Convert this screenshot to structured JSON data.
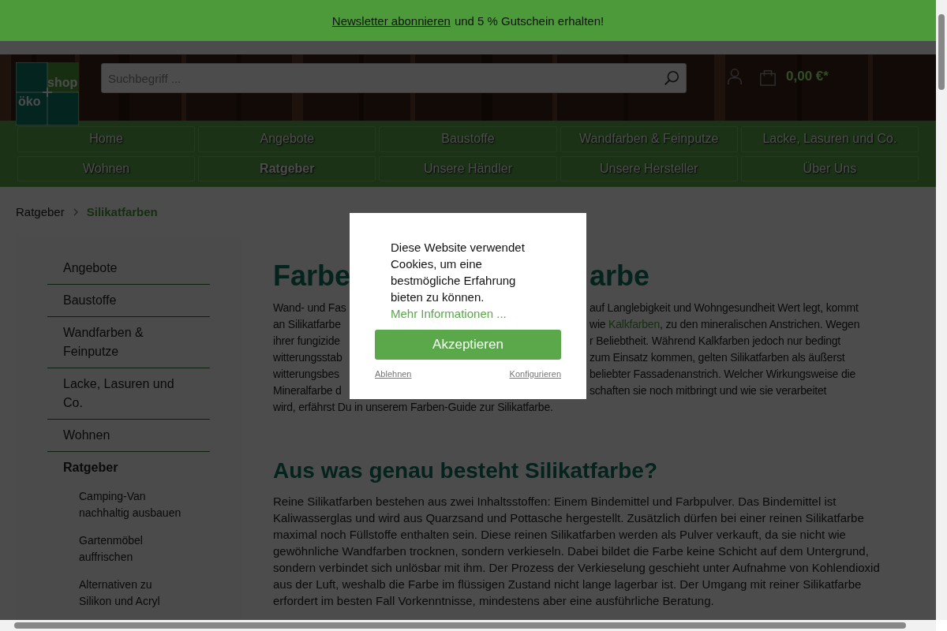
{
  "banner": {
    "link": "Newsletter abonnieren",
    "text": "und 5 % Gutschein erhalten!"
  },
  "logo": {
    "left": "öko",
    "right": "shop"
  },
  "search": {
    "placeholder": "Suchbegriff ..."
  },
  "cart": {
    "total": "0,00 €*"
  },
  "nav": [
    {
      "label": "Home",
      "selected": false
    },
    {
      "label": "Angebote",
      "selected": false
    },
    {
      "label": "Baustoffe",
      "selected": false
    },
    {
      "label": "Wandfarben & Feinputze",
      "selected": false
    },
    {
      "label": "Lacke, Lasuren und Co.",
      "selected": false
    },
    {
      "label": "Wohnen",
      "selected": false
    },
    {
      "label": "Ratgeber",
      "selected": true
    },
    {
      "label": "Unsere Händler",
      "selected": false
    },
    {
      "label": "Unsere Hersteller",
      "selected": false
    },
    {
      "label": "Über Uns",
      "selected": false
    }
  ],
  "breadcrumb": [
    {
      "label": "Ratgeber",
      "selected": false
    },
    {
      "label": "Silikatfarben",
      "selected": true
    }
  ],
  "sidebar": {
    "items": [
      {
        "label": "Angebote",
        "selected": false
      },
      {
        "label": "Baustoffe",
        "selected": false
      },
      {
        "label": "Wandfarben & Feinputze",
        "selected": false
      },
      {
        "label": "Lacke, Lasuren und Co.",
        "selected": false
      },
      {
        "label": "Wohnen",
        "selected": false
      },
      {
        "label": "Ratgeber",
        "selected": true,
        "children": [
          {
            "label": "Camping-Van nachhaltig ausbauen"
          },
          {
            "label": "Gartenmöbel auffrischen"
          },
          {
            "label": "Alternativen zu Silikon und Acryl"
          }
        ]
      }
    ]
  },
  "article": {
    "title_fragments": [
      "Farbe",
      "arbe"
    ],
    "intro_lines": [
      {
        "left": "Wand- und Fas",
        "right": [
          {
            "kind": "text",
            "text": "auf Langlebigkeit und Wohngesundheit Wert legt, kommt"
          }
        ]
      },
      {
        "left": "an Silikatfarbe",
        "right": [
          {
            "kind": "text",
            "text": "wie "
          },
          {
            "kind": "link",
            "text": "Kalkfarben"
          },
          {
            "kind": "text",
            "text": ", zu den mineralischen Anstrichen. Wegen"
          }
        ]
      },
      {
        "left": "ihrer fungizide",
        "right": [
          {
            "kind": "text",
            "text": "r Beliebtheit. Während Kalkfarben jedoch nur bedingt"
          }
        ]
      },
      {
        "left": "witterungsstab",
        "right": [
          {
            "kind": "text",
            "text": "zum Einsatz kommen, gelten Silikatfarben als äußerst"
          }
        ]
      },
      {
        "left": "witterungsbes",
        "right": [
          {
            "kind": "text",
            "text": "beliebter Fassadenanstrich. Welcher Wirkungsweise die"
          }
        ]
      },
      {
        "left": "Mineralfarbe d",
        "right": [
          {
            "kind": "text",
            "text": "schaften sie noch mitbringt und wie sie verarbeitet"
          }
        ]
      }
    ],
    "intro_last": "wird, erfährst Du in unserem Farben-Guide zur Silikatfarbe.",
    "heading": "Aus was genau besteht Silikatfarbe?",
    "paragraph": "Reine Silikatfarben bestehen aus zwei Inhaltsstoffen: Einem Bindemittel und Farbpulver. Das Bindemittel ist Kaliwasserglas und wird aus Quarzsand und Pottasche hergestellt. Zusätzlich dürfen bei einer reinen Silikatfarbe maximal noch Füllstoffe enthalten sein. Diese reinen Silikatfarben werden als Pulver verkauft, da sie nicht wie gewöhnliche Wandfarben trocknen, sondern verkieseln. Dabei bildet die Farbe keine Schicht auf dem Untergrund, sondern verbindet sich unlösbar mit ihm. Der Prozess der Verkieselung geschieht unter Aufnahme von Kohlendioxid aus der Luft, weshalb die Farbe im flüssigen Zustand nicht lange lagerbar ist. Der Umgang mit reiner Silikatfarbe erfordert im besten Fall Vorkenntnisse, mindestens aber eine ausführliche Beratung."
  },
  "cookie_dialog": {
    "message": "Diese Website verwendet Cookies, um eine bestmögliche Erfahrung bieten zu können.",
    "more_link": "Mehr Informationen ...",
    "accept": "Akzeptieren",
    "decline": "Ablehnen",
    "configure": "Konfigurieren"
  }
}
